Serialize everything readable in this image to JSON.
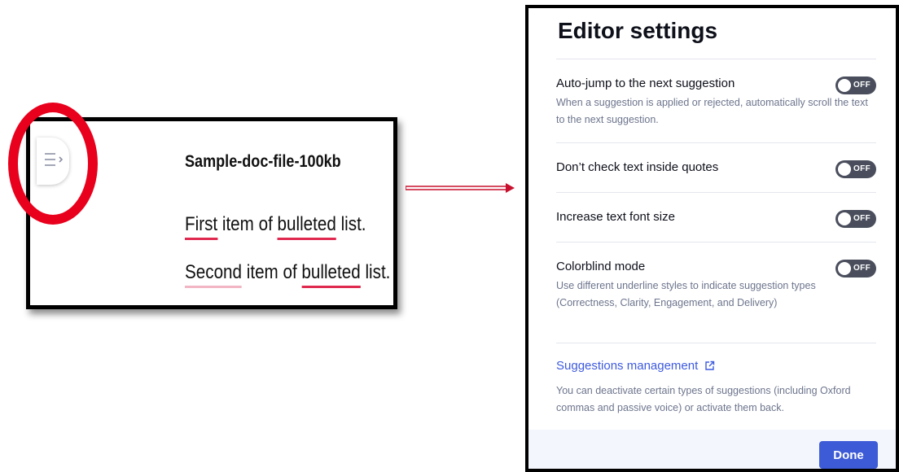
{
  "document": {
    "title": "Sample-doc-file-100kb",
    "line1": {
      "part1": "First",
      "part2": " item of ",
      "part3": "bulleted",
      "part4": " list."
    },
    "line2": {
      "part1": "Second",
      "part2": " item of ",
      "part3": "bulleted",
      "part4": " list."
    }
  },
  "settings": {
    "title": "Editor settings",
    "items": [
      {
        "label": "Auto-jump to the next suggestion",
        "description": "When a suggestion is applied or rejected, automatically scroll the text to the next suggestion.",
        "toggle": "OFF"
      },
      {
        "label": "Don’t check text inside quotes",
        "toggle": "OFF"
      },
      {
        "label": "Increase text font size",
        "toggle": "OFF"
      },
      {
        "label": "Colorblind mode",
        "description": "Use different underline styles to indicate suggestion types (Correctness, Clarity, Engagement, and Delivery)",
        "toggle": "OFF"
      }
    ],
    "management": {
      "link": "Suggestions management",
      "description": "You can deactivate certain types of suggestions (including Oxford commas and passive voice) or activate them back."
    },
    "done_label": "Done"
  },
  "colors": {
    "highlight": "#e8001c",
    "underline": "#e0294f",
    "toggle_off": "#4a4e5c",
    "link": "#3d5adf",
    "button": "#3d5bd6"
  }
}
